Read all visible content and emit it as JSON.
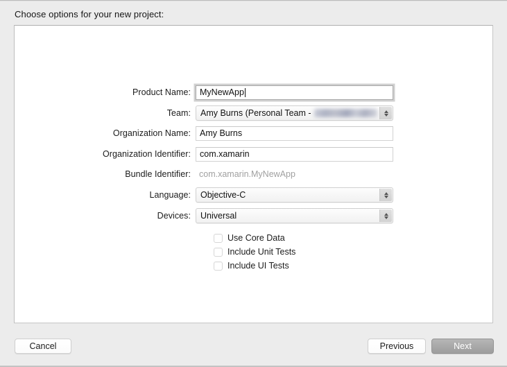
{
  "dialog": {
    "prompt": "Choose options for your new project:"
  },
  "form": {
    "fields": [
      {
        "id": "product-name",
        "label": "Product Name:",
        "value": "MyNewApp",
        "placeholder": "",
        "kind": "text",
        "focused": true
      },
      {
        "id": "team",
        "label": "Team:",
        "value": "Amy Burns (Personal Team -",
        "kind": "popup",
        "redacted": true
      },
      {
        "id": "organization-name",
        "label": "Organization Name:",
        "value": "Amy Burns",
        "placeholder": "",
        "kind": "text",
        "focused": false
      },
      {
        "id": "organization-identifier",
        "label": "Organization Identifier:",
        "value": "com.xamarin",
        "placeholder": "",
        "kind": "text",
        "focused": false
      },
      {
        "id": "bundle-identifier",
        "label": "Bundle Identifier:",
        "value": "com.xamarin.MyNewApp",
        "kind": "static"
      },
      {
        "id": "language",
        "label": "Language:",
        "value": "Objective-C",
        "kind": "popup",
        "redacted": false
      },
      {
        "id": "devices",
        "label": "Devices:",
        "value": "Universal",
        "kind": "popup",
        "redacted": false
      }
    ],
    "checkboxes": [
      {
        "id": "use-core-data",
        "label": "Use Core Data",
        "checked": false
      },
      {
        "id": "include-unit-tests",
        "label": "Include Unit Tests",
        "checked": false
      },
      {
        "id": "include-ui-tests",
        "label": "Include UI Tests",
        "checked": false
      }
    ]
  },
  "buttons": {
    "cancel": "Cancel",
    "previous": "Previous",
    "next": "Next"
  },
  "icons": {
    "stepper": "up-down-chevron-icon"
  },
  "colors": {
    "window_background": "#ececec",
    "panel_background": "#ffffff",
    "panel_border": "#c5c5c5",
    "text_primary": "#1b1b1b",
    "text_disabled": "#a0a0a0",
    "default_button_background": "#a8a8a8",
    "default_button_text": "#ffffff",
    "focus_ring": "#aaaaaa"
  }
}
